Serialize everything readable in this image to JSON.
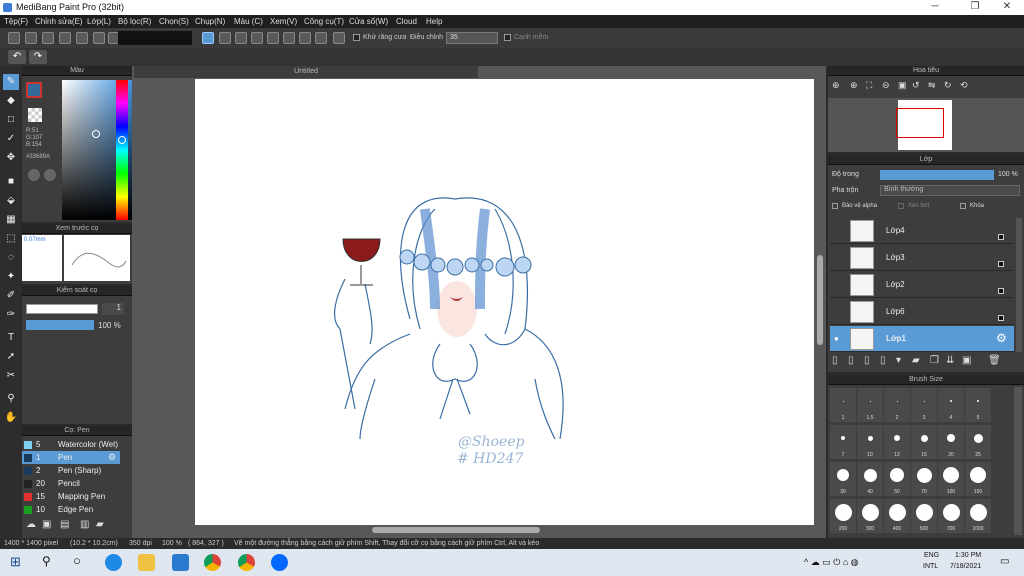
{
  "window": {
    "title": "MediBang Paint Pro (32bit)"
  },
  "menu": [
    "Tệp(F)",
    "Chỉnh sửa(E)",
    "Lớp(L)",
    "Bộ lọc(R)",
    "Chọn(S)",
    "Chụp(N)",
    "Màu (C)",
    "Xem(V)",
    "Công cụ(T)",
    "Cửa sổ(W)",
    "Cloud",
    "Help"
  ],
  "toolbar": {
    "antialias_label": "Khử răng cưa",
    "adjust_label": "Điều chỉnh",
    "adjust_value": "35",
    "edge_label": "Cạnh mềm"
  },
  "document": {
    "tab": "Untitled"
  },
  "color_panel": {
    "title": "Màu",
    "r": "R:51",
    "g": "G:107",
    "b": "B:154",
    "hex": "#33689A",
    "primary_color": "#33689A"
  },
  "brush_preview": {
    "title": "Xem trước cọ",
    "size": "0.07mm"
  },
  "brush_control": {
    "title": "Kiểm soát cọ",
    "size_value": "1",
    "opacity_value": "100 %"
  },
  "brush_list": {
    "title": "Cọ: Pen",
    "items": [
      {
        "size": "5",
        "name": "Watercolor (Wet)",
        "color": "#7fd0f0"
      },
      {
        "size": "1",
        "name": "Pen",
        "color": "#1a3a5a",
        "selected": true
      },
      {
        "size": "2",
        "name": "Pen (Sharp)",
        "color": "#1a3a5a"
      },
      {
        "size": "20",
        "name": "Pencil",
        "color": "#222222"
      },
      {
        "size": "15",
        "name": "Mapping Pen",
        "color": "#e03030"
      },
      {
        "size": "10",
        "name": "Edge Pen",
        "color": "#1aa020"
      }
    ]
  },
  "navigator": {
    "title": "Hoa tiêu"
  },
  "layers": {
    "title": "Lớp",
    "opacity_label": "Độ trong",
    "opacity_value": "100 %",
    "blend_label": "Pha trộn",
    "blend_value": "Bình thường",
    "alpha_label": "Bảo vệ alpha",
    "clip_label": "Xén bớt",
    "lock_label": "Khóa",
    "items": [
      {
        "name": "Lớp4"
      },
      {
        "name": "Lớp3"
      },
      {
        "name": "Lớp2"
      },
      {
        "name": "Lớp6"
      },
      {
        "name": "Lớp1",
        "selected": true
      }
    ]
  },
  "brush_size": {
    "title": "Brush Size",
    "sizes": [
      "1",
      "1.5",
      "2",
      "3",
      "4",
      "5",
      "7",
      "10",
      "12",
      "15",
      "20",
      "25",
      "30",
      "40",
      "50",
      "70",
      "100",
      "150",
      "200",
      "300",
      "400",
      "500",
      "700",
      "1000"
    ]
  },
  "status": {
    "dimensions": "1400 * 1400 pixel",
    "physical": "(10.2 * 10.2cm)",
    "dpi": "350 dpi",
    "zoom": "100 %",
    "coords": "( 864, 327 )",
    "hint": "Vẽ một đường thẳng bằng cách giữ phím Shift, Thay đổi cỡ cọ bằng cách giữ phím Ctrl, Alt và kéo"
  },
  "artwork": {
    "signature1": "@Shoeep",
    "signature2": "# HD247"
  },
  "taskbar": {
    "lang1": "ENG",
    "lang2": "INTL",
    "time": "1:30 PM",
    "date": "7/18/2021"
  }
}
